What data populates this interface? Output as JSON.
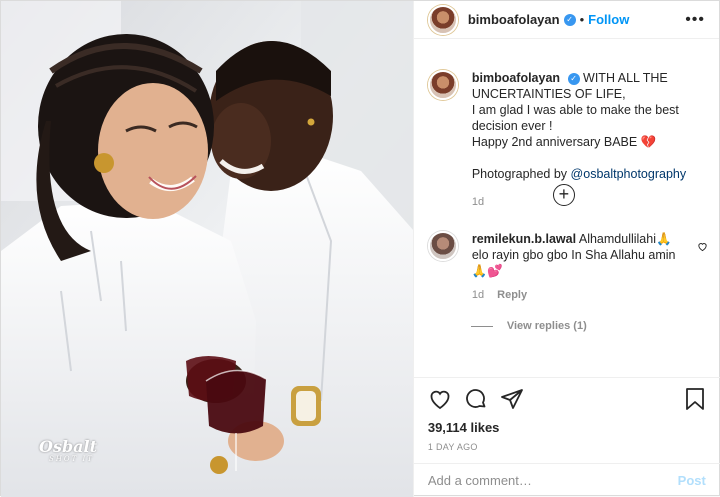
{
  "photo": {
    "alt_icon": "couple-photo",
    "watermark_line1": "Osbalt",
    "watermark_line2": "SHOT IT"
  },
  "header": {
    "username": "bimboafolayan",
    "follow_label": "Follow",
    "more_icon": "more-horizontal-icon"
  },
  "caption": {
    "username": "bimboafolayan",
    "line1": "WITH ALL THE UNCERTAINTIES OF LIFE,",
    "line2": "I am glad I was able to make the best decision ever !",
    "line3": "Happy 2nd anniversary BABE 💔",
    "photo_credit_prefix": "Photographed by ",
    "photo_credit_mention": "@osbaltphotography",
    "time": "1d"
  },
  "comment": {
    "username": "remilekun.b.lawal",
    "text": "Alhamdullilahi🙏 elo rayin gbo gbo In Sha Allahu amin 🙏💕",
    "time": "1d",
    "reply_label": "Reply",
    "view_replies": "View replies (1)"
  },
  "actions": {
    "likes": "39,114 likes",
    "ago": "1 DAY AGO"
  },
  "add_comment": {
    "placeholder": "Add a comment…",
    "post_label": "Post"
  },
  "colors": {
    "accent": "#0095f6",
    "verified": "#3897f0",
    "post_disabled": "#b2dffc",
    "muted": "#8e8e8e"
  }
}
